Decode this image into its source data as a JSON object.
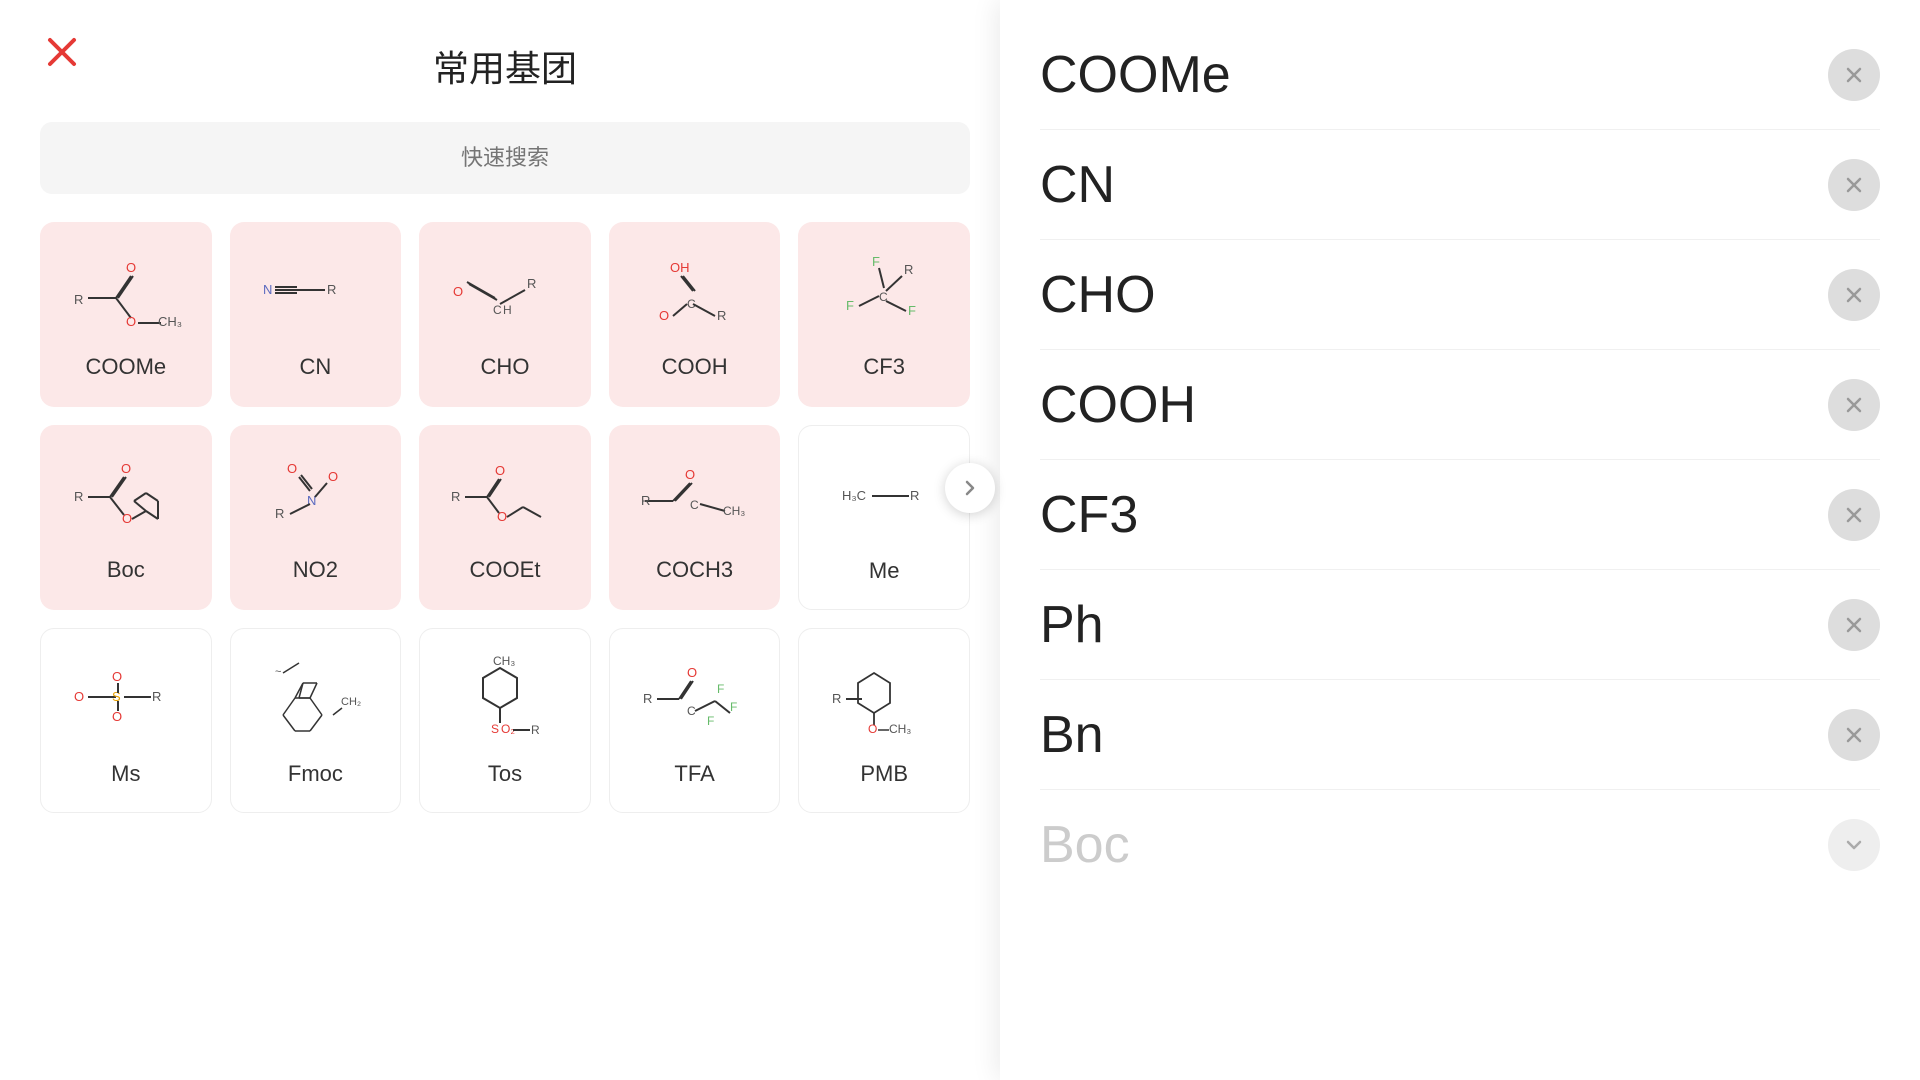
{
  "title": "常用基团",
  "search": {
    "placeholder": "快速搜索"
  },
  "close_label": "×",
  "cards": [
    {
      "id": "COOMe",
      "label": "COOMe",
      "type": "pink"
    },
    {
      "id": "CN",
      "label": "CN",
      "type": "pink"
    },
    {
      "id": "CHO",
      "label": "CHO",
      "type": "pink"
    },
    {
      "id": "COOH",
      "label": "COOH",
      "type": "pink"
    },
    {
      "id": "CF3",
      "label": "CF3",
      "type": "pink"
    },
    {
      "id": "Boc",
      "label": "Boc",
      "type": "pink"
    },
    {
      "id": "NO2",
      "label": "NO2",
      "type": "pink"
    },
    {
      "id": "COOEt",
      "label": "COOEt",
      "type": "pink"
    },
    {
      "id": "COCH3",
      "label": "COCH3",
      "type": "pink"
    },
    {
      "id": "Me",
      "label": "Me",
      "type": "white"
    },
    {
      "id": "Ms",
      "label": "Ms",
      "type": "white"
    },
    {
      "id": "Fmoc",
      "label": "Fmoc",
      "type": "white"
    },
    {
      "id": "Tos",
      "label": "Tos",
      "type": "white"
    },
    {
      "id": "TFA",
      "label": "TFA",
      "type": "white"
    },
    {
      "id": "PMB",
      "label": "PMB",
      "type": "white"
    }
  ],
  "right_panel": {
    "items": [
      {
        "id": "COOMe",
        "label": "COOMe"
      },
      {
        "id": "CN",
        "label": "CN"
      },
      {
        "id": "CHO",
        "label": "CHO"
      },
      {
        "id": "COOH",
        "label": "COOH"
      },
      {
        "id": "CF3",
        "label": "CF3"
      },
      {
        "id": "Ph",
        "label": "Ph"
      },
      {
        "id": "Bn",
        "label": "Bn"
      },
      {
        "id": "Boc2",
        "label": "Boc"
      }
    ]
  }
}
